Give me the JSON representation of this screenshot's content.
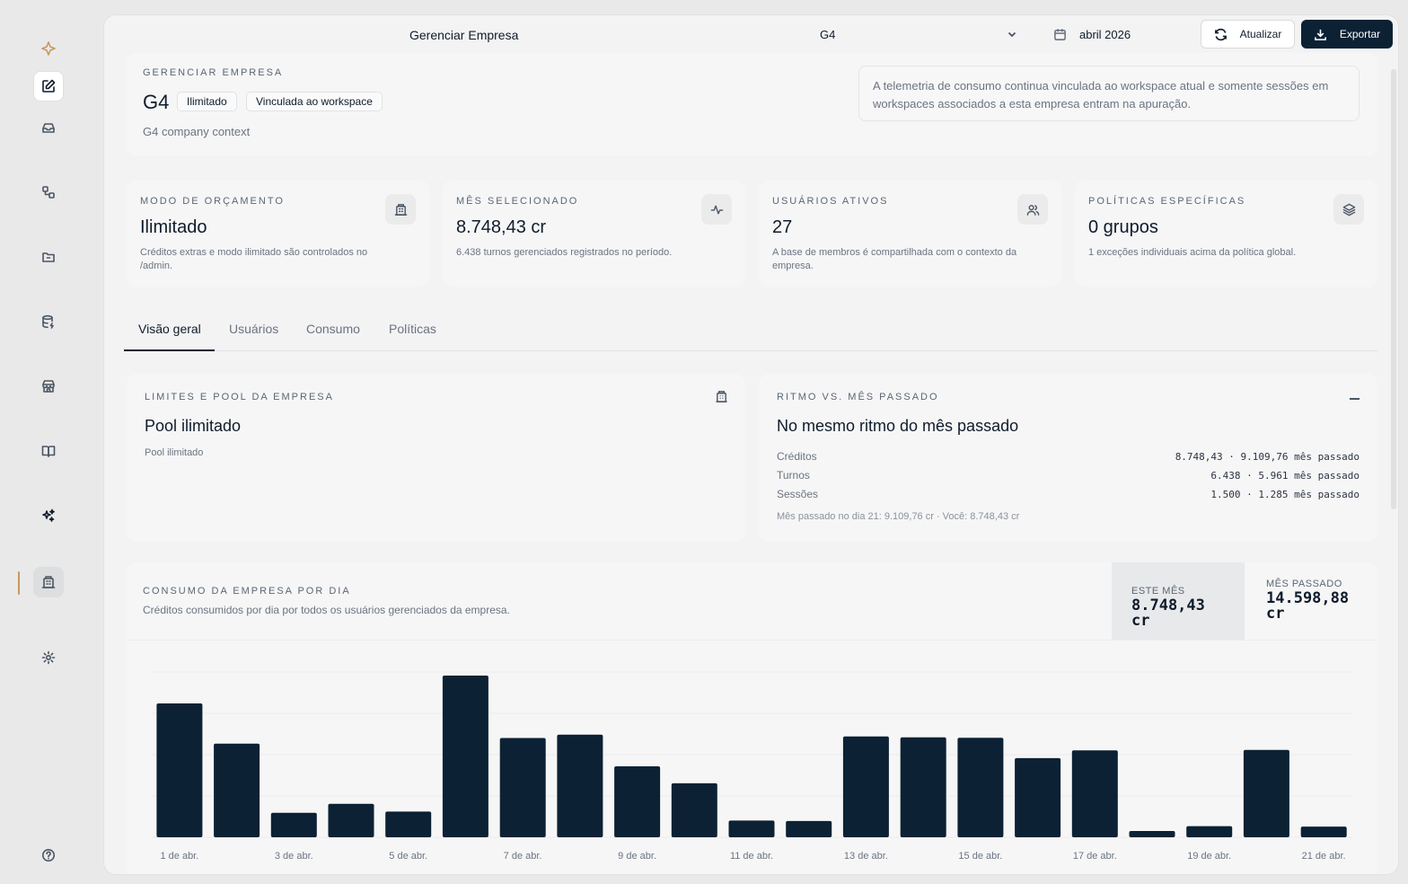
{
  "topbar": {
    "title": "Gerenciar Empresa",
    "company_select": "G4",
    "date": "abril 2026",
    "refresh_label": "Atualizar",
    "export_label": "Exportar"
  },
  "company": {
    "eyebrow": "GERENCIAR EMPRESA",
    "name": "G4",
    "chips": [
      "Ilimitado",
      "Vinculada ao workspace"
    ],
    "context": "G4 company context",
    "notice": "A telemetria de consumo continua vinculada ao workspace atual e somente sessões em workspaces associados a esta empresa entram na apuração."
  },
  "stats": [
    {
      "label": "MODO DE ORÇAMENTO",
      "value": "Ilimitado",
      "desc": "Créditos extras e modo ilimitado são controlados no /admin.",
      "icon": "building-icon"
    },
    {
      "label": "MÊS SELECIONADO",
      "value": "8.748,43 cr",
      "desc": "6.438 turnos gerenciados registrados no período.",
      "icon": "activity-icon"
    },
    {
      "label": "USUÁRIOS ATIVOS",
      "value": "27",
      "desc": "A base de membros é compartilhada com o contexto da empresa.",
      "icon": "users-icon"
    },
    {
      "label": "POLÍTICAS ESPECÍFICAS",
      "value": "0 grupos",
      "desc": "1 exceções individuais acima da política global.",
      "icon": "layers-icon"
    }
  ],
  "tabs": [
    "Visão geral",
    "Usuários",
    "Consumo",
    "Políticas"
  ],
  "limits_card": {
    "eyebrow": "LIMITES E POOL DA EMPRESA",
    "title": "Pool ilimitado",
    "sub": "Pool ilimitado"
  },
  "pace_card": {
    "eyebrow": "RITMO VS. MÊS PASSADO",
    "title": "No mesmo ritmo do mês passado",
    "rows": [
      {
        "label": "Créditos",
        "value": "8.748,43 · 9.109,76 mês passado"
      },
      {
        "label": "Turnos",
        "value": "6.438 · 5.961 mês passado"
      },
      {
        "label": "Sessões",
        "value": "1.500 · 1.285 mês passado"
      }
    ],
    "footer": "Mês passado no dia 21: 9.109,76 cr · Você: 8.748,43 cr"
  },
  "consumption_card": {
    "eyebrow": "CONSUMO DA EMPRESA POR DIA",
    "sub": "Créditos consumidos por dia por todos os usuários gerenciados da empresa.",
    "this_month_label": "ESTE MÊS",
    "this_month_value": "8.748,43 cr",
    "last_month_label": "MÊS PASSADO",
    "last_month_value": "14.598,88 cr"
  },
  "chart_data": {
    "type": "bar",
    "categories": [
      "1 de abr.",
      "2 de abr.",
      "3 de abr.",
      "4 de abr.",
      "5 de abr.",
      "6 de abr.",
      "7 de abr.",
      "8 de abr.",
      "9 de abr.",
      "10 de abr.",
      "11 de abr.",
      "12 de abr.",
      "13 de abr.",
      "14 de abr.",
      "15 de abr.",
      "16 de abr.",
      "17 de abr.",
      "18 de abr.",
      "19 de abr.",
      "20 de abr.",
      "21 de abr."
    ],
    "tick_labels": [
      "1 de abr.",
      "3 de abr.",
      "5 de abr.",
      "7 de abr.",
      "9 de abr.",
      "11 de abr.",
      "13 de abr.",
      "15 de abr.",
      "17 de abr.",
      "19 de abr.",
      "21 de abr."
    ],
    "values": [
      600,
      420,
      110,
      150,
      115,
      725,
      445,
      460,
      318,
      242,
      75,
      73,
      452,
      448,
      446,
      355,
      390,
      28,
      50,
      392,
      48
    ],
    "bar_color": "#0c2134",
    "grid": true
  }
}
